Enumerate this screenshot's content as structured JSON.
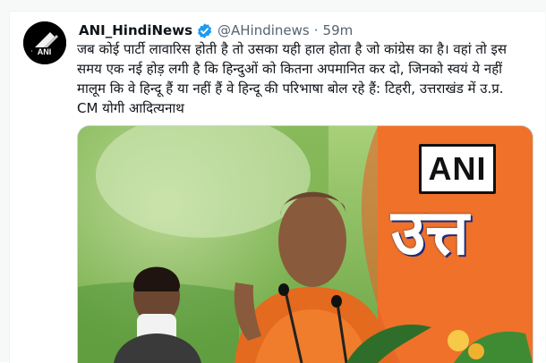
{
  "tweet": {
    "author_name": "ANI_HindiNews",
    "handle": "@AHindinews",
    "separator": "·",
    "time": "59m",
    "text": "जब कोई पार्टी लावारिस होती है तो उसका यही हाल होता है जो कांग्रेस का है। वहां तो इस\nसमय एक नई होड़ लगी है कि हिन्दुओं को कितना अपमानित कर दो, जिनको स्वयं ये नहीं\nमालूम कि वे हिन्दू हैं या नहीं हैं वे हिन्दू की परिभाषा बोल रहे हैं: टिहरी, उत्तराखंड में उ.प्र.\nCM योगी आदित्यनाथ"
  },
  "avatar": {
    "logo_text": "ANI",
    "icon": "ani-logo-icon"
  },
  "media": {
    "badge_text": "ANI",
    "banner_text": "उत्त"
  },
  "colors": {
    "verified": "#1d9bf0",
    "text": "#0f1419",
    "muted": "#536471",
    "saffron": "#f0712a",
    "green": "#5fa63a"
  }
}
